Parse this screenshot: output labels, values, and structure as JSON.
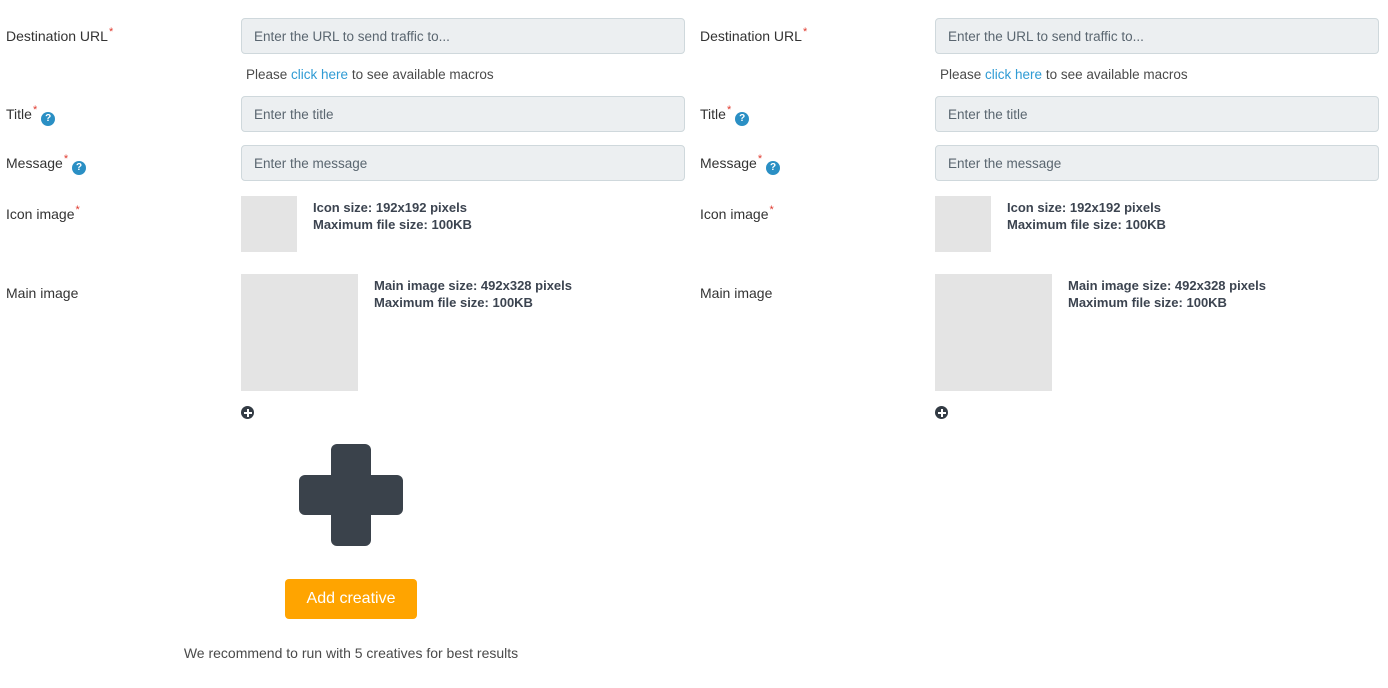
{
  "creatives": [
    {
      "destination_url": {
        "label": "Destination URL",
        "required": true,
        "placeholder": "Enter the URL to send traffic to..."
      },
      "macro_note": {
        "prefix": "Please ",
        "link": "click here",
        "suffix": " to see available macros"
      },
      "title": {
        "label": "Title",
        "required": true,
        "has_help": true,
        "placeholder": "Enter the title"
      },
      "message": {
        "label": "Message",
        "required": true,
        "has_help": true,
        "placeholder": "Enter the message"
      },
      "icon_image": {
        "label": "Icon image",
        "required": true,
        "spec_line1": "Icon size: 192x192 pixels",
        "spec_line2": "Maximum file size: 100KB"
      },
      "main_image": {
        "label": "Main image",
        "required": false,
        "spec_line1": "Main image size: 492x328 pixels",
        "spec_line2": "Maximum file size: 100KB"
      },
      "add_more_icon": "plus-circle-icon"
    },
    {
      "destination_url": {
        "label": "Destination URL",
        "required": true,
        "placeholder": "Enter the URL to send traffic to..."
      },
      "macro_note": {
        "prefix": "Please ",
        "link": "click here",
        "suffix": " to see available macros"
      },
      "title": {
        "label": "Title",
        "required": true,
        "has_help": true,
        "placeholder": "Enter the title"
      },
      "message": {
        "label": "Message",
        "required": true,
        "has_help": true,
        "placeholder": "Enter the message"
      },
      "icon_image": {
        "label": "Icon image",
        "required": true,
        "spec_line1": "Icon size: 192x192 pixels",
        "spec_line2": "Maximum file size: 100KB"
      },
      "main_image": {
        "label": "Main image",
        "required": false,
        "spec_line1": "Main image size: 492x328 pixels",
        "spec_line2": "Maximum file size: 100KB"
      },
      "add_more_icon": "plus-circle-icon"
    }
  ],
  "add_creative": {
    "plus_icon": "big-plus-icon",
    "button_label": "Add creative",
    "recommendation": "We recommend to run with 5 creatives for best results"
  },
  "markers": {
    "required_star": "*",
    "help_glyph": "?"
  },
  "colors": {
    "required_red": "#e03a2f",
    "help_blue": "#2a8fc4",
    "link_blue": "#2f9bd4",
    "button_orange": "#ffa400",
    "plus_dark": "#3a424b",
    "input_bg": "#eceff1",
    "thumb_gray": "#e4e4e4"
  }
}
